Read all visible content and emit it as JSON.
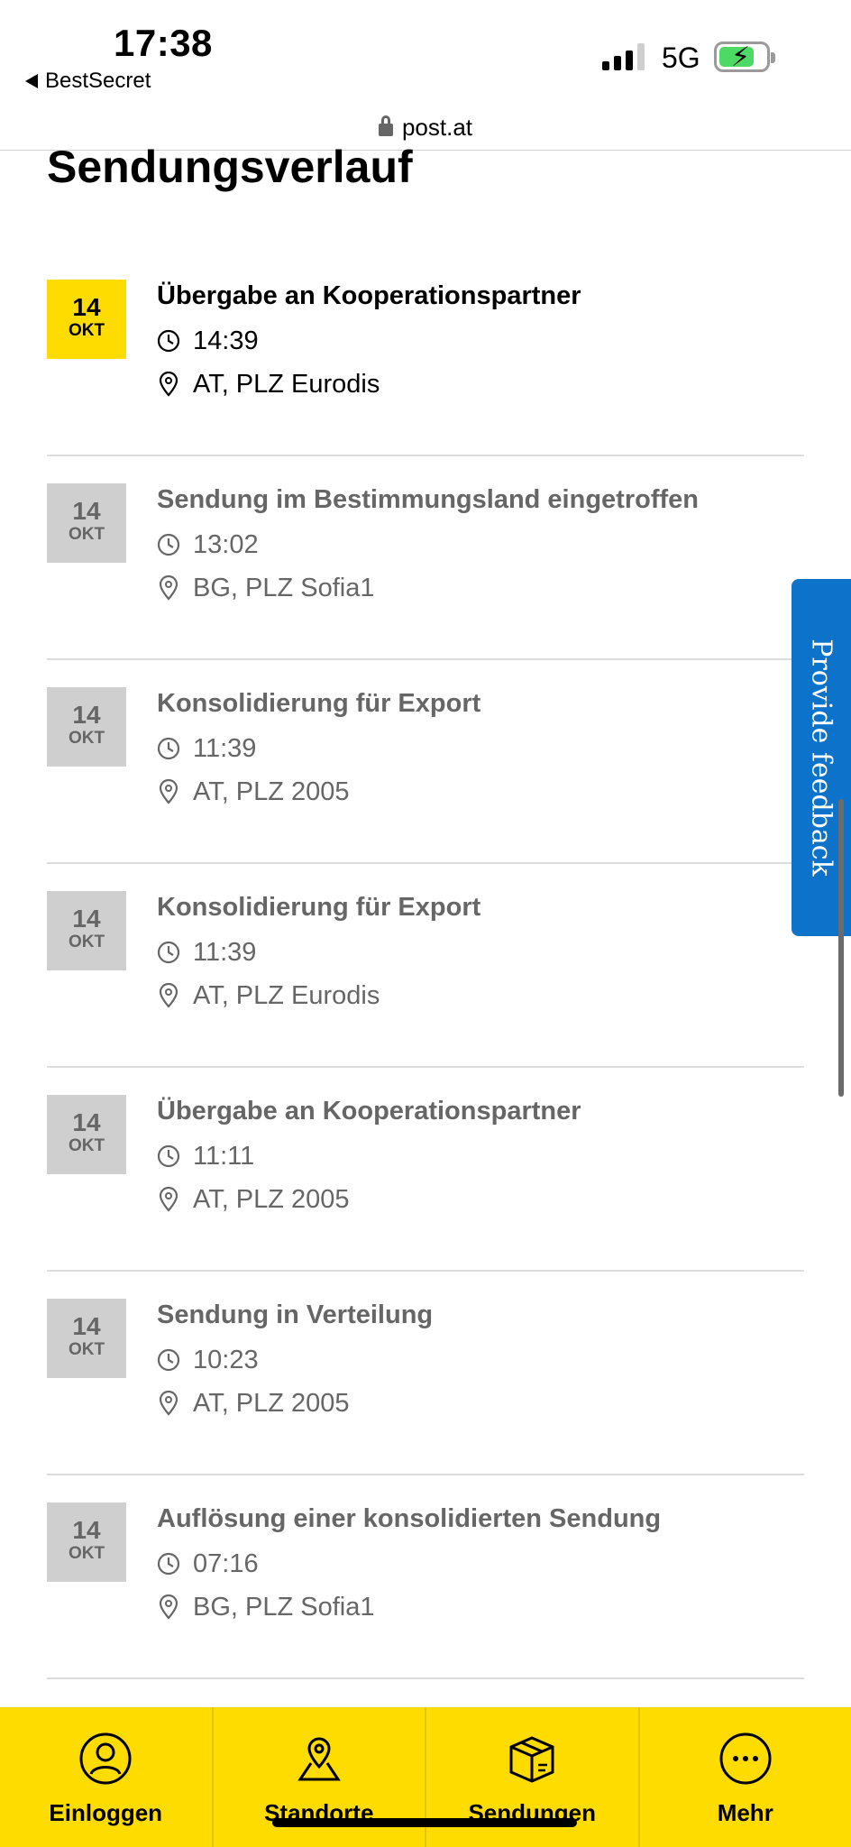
{
  "status_bar": {
    "time": "17:38",
    "back_app": "BestSecret",
    "network": "5G"
  },
  "url_bar": {
    "domain": "post.at"
  },
  "page": {
    "title": "Sendungsverlauf"
  },
  "events": [
    {
      "day": "14",
      "month": "OKT",
      "title": "Übergabe an Kooperationspartner",
      "time": "14:39",
      "location": "AT, PLZ Eurodis",
      "current": true
    },
    {
      "day": "14",
      "month": "OKT",
      "title": "Sendung im Bestimmungsland eingetroffen",
      "time": "13:02",
      "location": "BG, PLZ Sofia1",
      "current": false
    },
    {
      "day": "14",
      "month": "OKT",
      "title": "Konsolidierung für Export",
      "time": "11:39",
      "location": "AT, PLZ 2005",
      "current": false
    },
    {
      "day": "14",
      "month": "OKT",
      "title": "Konsolidierung für Export",
      "time": "11:39",
      "location": "AT, PLZ Eurodis",
      "current": false
    },
    {
      "day": "14",
      "month": "OKT",
      "title": "Übergabe an Kooperationspartner",
      "time": "11:11",
      "location": "AT, PLZ 2005",
      "current": false
    },
    {
      "day": "14",
      "month": "OKT",
      "title": "Sendung in Verteilung",
      "time": "10:23",
      "location": "AT, PLZ 2005",
      "current": false
    },
    {
      "day": "14",
      "month": "OKT",
      "title": "Auflösung einer konsolidierten Sendung",
      "time": "07:16",
      "location": "BG, PLZ Sofia1",
      "current": false
    }
  ],
  "feedback": {
    "label": "Provide feedback",
    "color": "#0d72c9"
  },
  "bottom_nav": [
    {
      "label": "Einloggen",
      "icon": "user-icon"
    },
    {
      "label": "Standorte",
      "icon": "map-pin-icon"
    },
    {
      "label": "Sendungen",
      "icon": "package-icon"
    },
    {
      "label": "Mehr",
      "icon": "more-icon"
    }
  ],
  "colors": {
    "accent": "#ffdc00",
    "muted": "#666666",
    "badge_inactive": "#cfcfcf"
  }
}
